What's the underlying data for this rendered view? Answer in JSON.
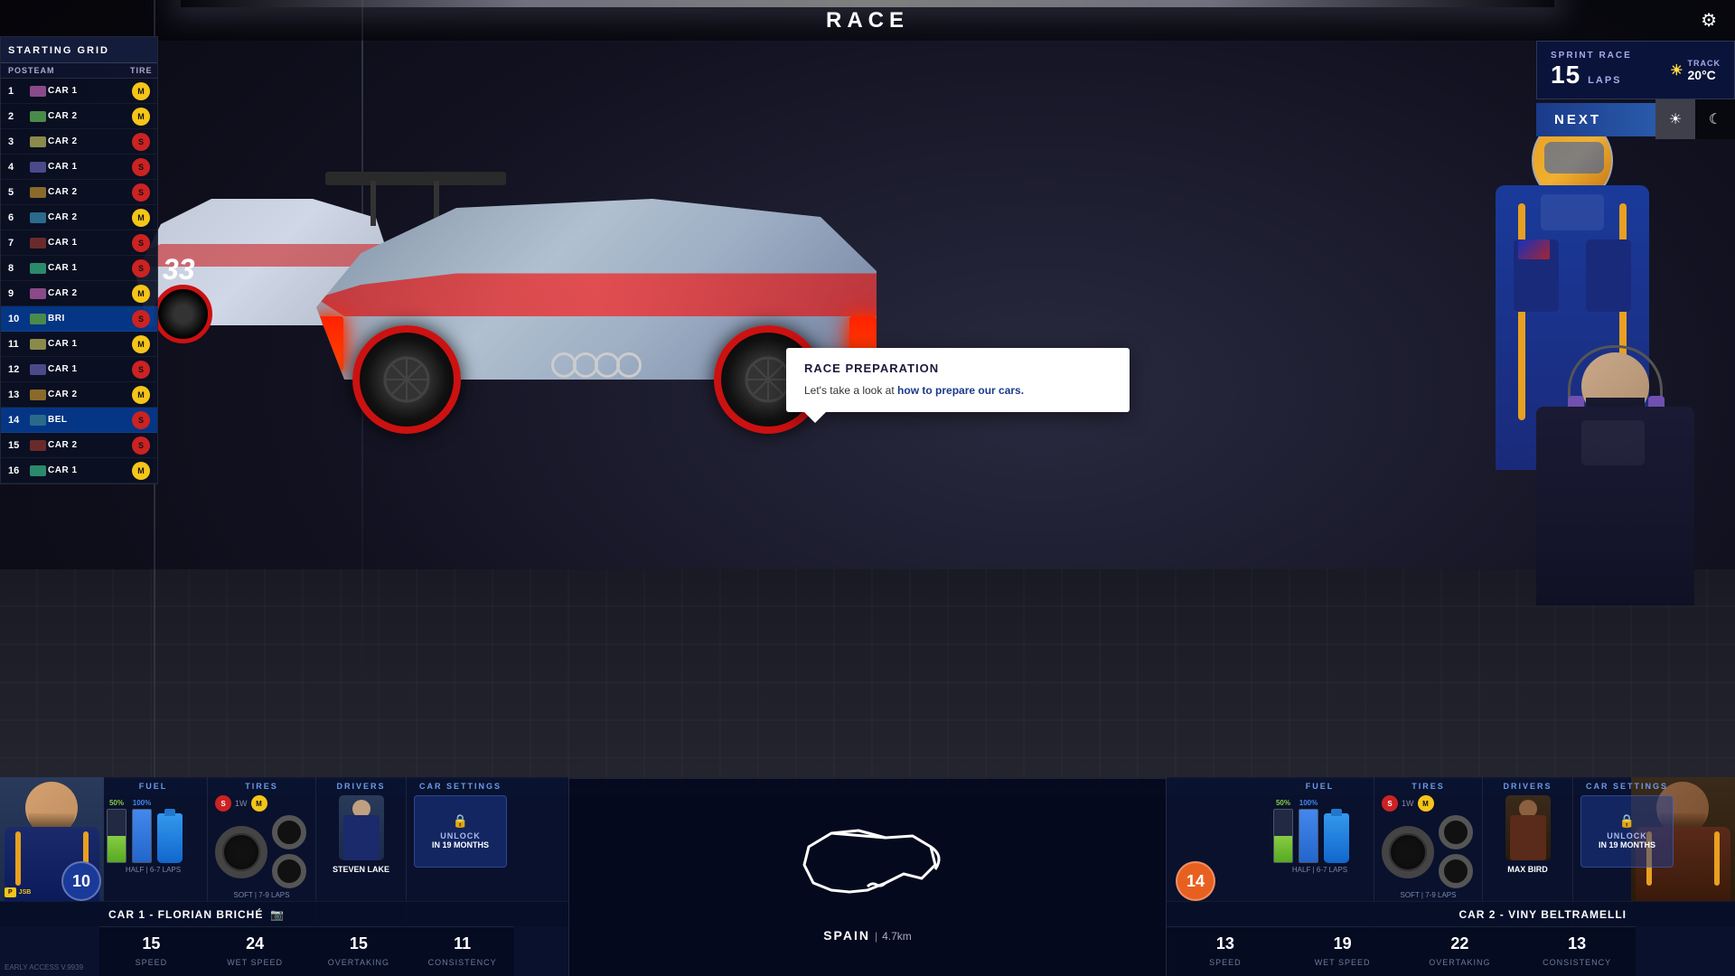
{
  "title": "RACE",
  "settings_icon": "⚙",
  "starting_grid": {
    "header": "STARTING GRID",
    "col_pos": "POS",
    "col_team": "TEAM",
    "col_tire": "TIRE",
    "rows": [
      {
        "pos": 1,
        "car": "CAR 1",
        "tire": "M",
        "tire_class": "tire-m",
        "highlight": false
      },
      {
        "pos": 2,
        "car": "CAR 2",
        "tire": "M",
        "tire_class": "tire-m",
        "highlight": false
      },
      {
        "pos": 3,
        "car": "CAR 2",
        "tire": "S",
        "tire_class": "tire-s",
        "highlight": false
      },
      {
        "pos": 4,
        "car": "CAR 1",
        "tire": "S",
        "tire_class": "tire-s",
        "highlight": false
      },
      {
        "pos": 5,
        "car": "CAR 2",
        "tire": "S",
        "tire_class": "tire-s",
        "highlight": false
      },
      {
        "pos": 6,
        "car": "CAR 2",
        "tire": "M",
        "tire_class": "tire-m",
        "highlight": false
      },
      {
        "pos": 7,
        "car": "CAR 1",
        "tire": "S",
        "tire_class": "tire-s",
        "highlight": false
      },
      {
        "pos": 8,
        "car": "CAR 1",
        "tire": "S",
        "tire_class": "tire-s",
        "highlight": false
      },
      {
        "pos": 9,
        "car": "CAR 2",
        "tire": "M",
        "tire_class": "tire-m",
        "highlight": false
      },
      {
        "pos": 10,
        "car": "BRI",
        "tire": "S",
        "tire_class": "tire-s",
        "highlight": true
      },
      {
        "pos": 11,
        "car": "CAR 1",
        "tire": "M",
        "tire_class": "tire-m",
        "highlight": false
      },
      {
        "pos": 12,
        "car": "CAR 1",
        "tire": "S",
        "tire_class": "tire-s",
        "highlight": false
      },
      {
        "pos": 13,
        "car": "CAR 2",
        "tire": "M",
        "tire_class": "tire-m",
        "highlight": false
      },
      {
        "pos": 14,
        "car": "BEL",
        "tire": "S",
        "tire_class": "tire-s",
        "highlight": true
      },
      {
        "pos": 15,
        "car": "CAR 2",
        "tire": "S",
        "tire_class": "tire-s",
        "highlight": false
      },
      {
        "pos": 16,
        "car": "CAR 1",
        "tire": "M",
        "tire_class": "tire-m",
        "highlight": false
      }
    ]
  },
  "race_info": {
    "sprint_race_label": "SPRINT RACE",
    "laps": "15",
    "laps_label": "LAPS",
    "track_temp_label": "TRACK",
    "track_temp": "20°C"
  },
  "next_button": "NEXT",
  "race_prep": {
    "title": "RACE PREPARATION",
    "text_before": "Let's take a look at ",
    "text_link": "how to prepare our cars.",
    "text_after": ""
  },
  "car1": {
    "number": "10",
    "fuel_label": "FUEL",
    "fuel_50": "50%",
    "fuel_100": "100%",
    "fuel_laps": "HALF | 6-7 LAPS",
    "tires_label": "TIRES",
    "tire_type": "S",
    "tire_week": "1W",
    "tire_type2": "M",
    "tire_laps": "SOFT | 7-9 LAPS",
    "drivers_label": "DRIVERS",
    "driver_name": "STEVEN LAKE",
    "car_settings_title": "CAR SETTINGS",
    "car_settings_unlock": "UNLOCK",
    "car_settings_time": "IN 19 MONTHS",
    "stats": {
      "speed": "15",
      "speed_label": "SPEED",
      "wet_speed": "24",
      "wet_speed_label": "WET SPEED",
      "overtaking": "15",
      "overtaking_label": "OVERTAKING",
      "consistency": "11",
      "consistency_label": "CONSISTENCY"
    },
    "driver_full": "CAR 1 - FLORIAN BRICHÉ"
  },
  "car2": {
    "number": "14",
    "fuel_label": "FUEL",
    "fuel_50": "50%",
    "fuel_100": "100%",
    "fuel_laps": "HALF | 6-7 LAPS",
    "tires_label": "TIRES",
    "tire_type": "S",
    "tire_week": "1W",
    "tire_type2": "M",
    "tire_laps": "SOFT | 7-9 LAPS",
    "drivers_label": "DRIVERS",
    "driver_name": "MAX BIRD",
    "car_settings_title": "CAR SETTINGS",
    "car_settings_unlock": "UNLOCK",
    "car_settings_time": "IN 19 MONTHS",
    "stats": {
      "speed": "13",
      "speed_label": "SPEED",
      "wet_speed": "19",
      "wet_speed_label": "WET SPEED",
      "overtaking": "22",
      "overtaking_label": "OVERTAKING",
      "consistency": "13",
      "consistency_label": "CONSISTENCY"
    },
    "driver_full": "CAR 2 - VINY BELTRAMELLI"
  },
  "circuit": {
    "name": "SPAIN",
    "length": "4.7km"
  },
  "version": "EARLY ACCESS V.9939"
}
